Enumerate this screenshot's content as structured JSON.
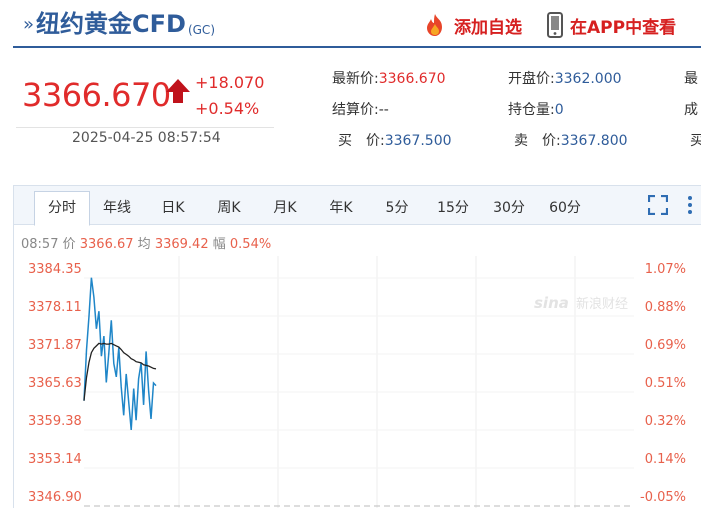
{
  "header": {
    "title": "纽约黄金CFD",
    "title_sub": "(GC)",
    "watch_label": "添加自选",
    "app_label": "在APP中查看"
  },
  "quote": {
    "price": "3366.670",
    "change": "+18.070",
    "change_pct": "+0.54%",
    "timestamp": "2025-04-25 08:57:54",
    "fields": {
      "latest_label": "最新价:",
      "latest_value": "3366.670",
      "open_label": "开盘价:",
      "open_value": "3362.000",
      "high_label": "最",
      "settle_label": "结算价:",
      "settle_value": "--",
      "oi_label": "持仓量:",
      "oi_value": "0",
      "vol_label": "成",
      "bid_label": "买　价:",
      "bid_value": "3367.500",
      "ask_label": "卖　价:",
      "ask_value": "3367.800",
      "extra_label": "买"
    }
  },
  "tabs": [
    {
      "label": "分时",
      "active": true
    },
    {
      "label": "年线"
    },
    {
      "label": "日K"
    },
    {
      "label": "周K"
    },
    {
      "label": "月K"
    },
    {
      "label": "年K"
    },
    {
      "label": "5分"
    },
    {
      "label": "15分"
    },
    {
      "label": "30分"
    },
    {
      "label": "60分"
    }
  ],
  "info_line": {
    "time": "08:57",
    "price_label": "价",
    "price": "3366.67",
    "avg_label": "均",
    "avg": "3369.42",
    "amp_label": "幅",
    "amp": "0.54%"
  },
  "watermark": "新浪财经",
  "watermark_logo": "sina",
  "colors": {
    "accent": "#2f5c9a",
    "up": "#e02b2b",
    "price_line": "#1f86c8",
    "avg_line": "#222222",
    "axis_label": "#e8614c"
  },
  "chart_data": {
    "type": "line",
    "y_ticks_left": [
      "3384.35",
      "3378.11",
      "3371.87",
      "3365.63",
      "3359.38",
      "3353.14",
      "3346.90"
    ],
    "y_ticks_right": [
      "1.07%",
      "0.88%",
      "0.69%",
      "0.51%",
      "0.32%",
      "0.14%",
      "-0.05%"
    ],
    "ylim": [
      3346.9,
      3384.35
    ],
    "grid": true,
    "series": [
      {
        "values": [
          3364.2,
          3372.5,
          3378.1,
          3384.4,
          3381.2,
          3376.0,
          3378.9,
          3371.5,
          3374.8,
          3367.2,
          3372.0,
          3377.4,
          3370.3,
          3368.1,
          3372.9,
          3366.5,
          3361.8,
          3368.6,
          3364.0,
          3359.4,
          3366.2,
          3361.0,
          3367.8,
          3370.4,
          3363.5,
          3372.3,
          3365.9,
          3361.2,
          3367.1,
          3366.67
        ]
      },
      {
        "values": [
          3364.2,
          3368.0,
          3370.5,
          3372.1,
          3372.8,
          3373.2,
          3373.6,
          3373.5,
          3373.6,
          3373.5,
          3373.5,
          3373.6,
          3373.4,
          3373.2,
          3373.0,
          3372.6,
          3372.1,
          3371.8,
          3371.5,
          3371.1,
          3370.9,
          3370.6,
          3370.5,
          3370.4,
          3370.1,
          3370.0,
          3369.9,
          3369.7,
          3369.5,
          3369.42
        ]
      }
    ]
  }
}
